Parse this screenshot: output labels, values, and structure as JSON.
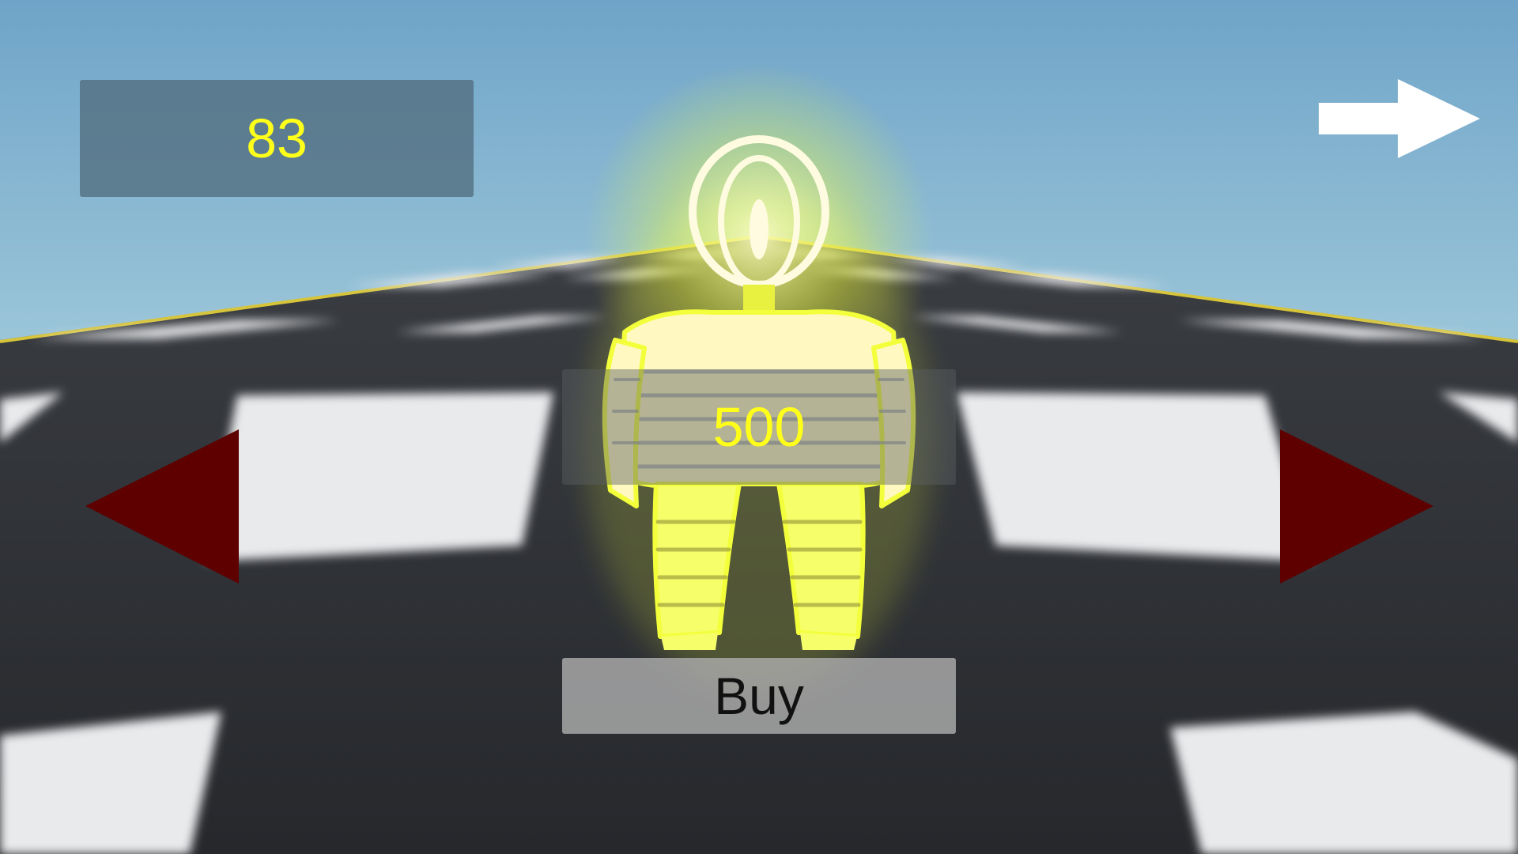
{
  "hud": {
    "coins": "83"
  },
  "shop": {
    "price": "500",
    "buy_label": "Buy"
  },
  "icons": {
    "prev": "triangle-left-icon",
    "next": "triangle-right-icon",
    "continue": "arrow-right-icon"
  },
  "colors": {
    "sky_top": "#6fa4c8",
    "sky_horizon": "#9cc6d9",
    "text_accent": "#ffff1a",
    "arrow_red": "#5e0000",
    "character_glow": "#f2ff3a"
  }
}
